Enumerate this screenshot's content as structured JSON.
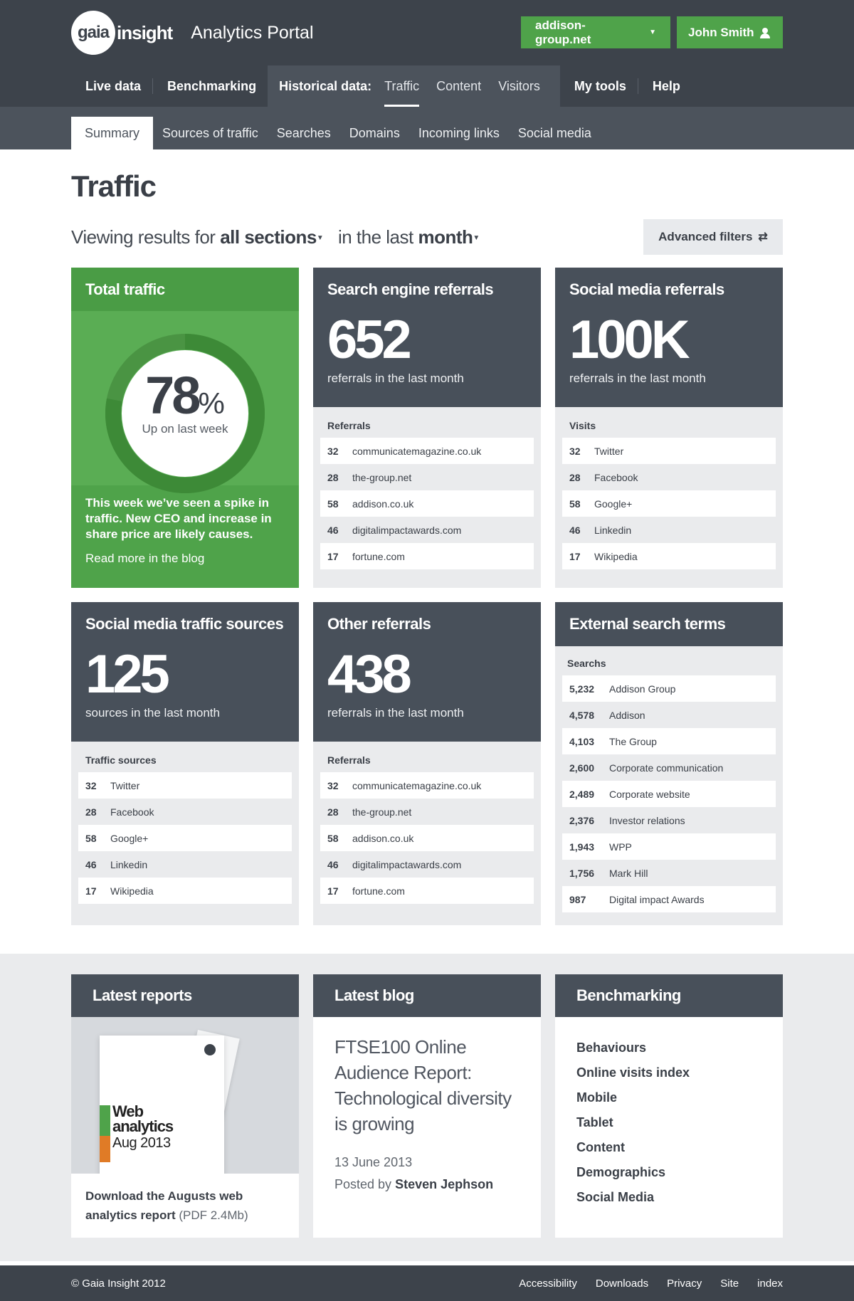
{
  "header": {
    "logo_circle": "gaia",
    "logo_word": "insight",
    "portal_title": "Analytics Portal",
    "site_button": "addison-group.net",
    "user_button": "John Smith"
  },
  "main_nav": {
    "live_data": "Live data",
    "benchmarking": "Benchmarking",
    "historical_label": "Historical data:",
    "historical_items": [
      "Traffic",
      "Content",
      "Visitors"
    ],
    "my_tools": "My tools",
    "help": "Help"
  },
  "sub_nav": [
    "Summary",
    "Sources of traffic",
    "Searches",
    "Domains",
    "Incoming links",
    "Social media"
  ],
  "page": {
    "title": "Traffic",
    "viewing_prefix": "Viewing results for",
    "sections": "all sections",
    "in_the_last": "in the last",
    "period": "month",
    "advanced_filters": "Advanced filters"
  },
  "total_traffic": {
    "title": "Total traffic",
    "percent": "78",
    "percent_sign": "%",
    "percent_value": 0.78,
    "subtitle": "Up on last week",
    "body": "This week we’ve seen a spike in traffic. New CEO and  increase in share price are likely causes.",
    "link": "Read more in the blog"
  },
  "search_engine": {
    "title": "Search engine referrals",
    "number": "652",
    "subtitle": "referrals in the last month",
    "list_label": "Referrals",
    "rows": [
      {
        "n": "32",
        "label": "communicatemagazine.co.uk"
      },
      {
        "n": "28",
        "label": "the-group.net"
      },
      {
        "n": "58",
        "label": "addison.co.uk"
      },
      {
        "n": "46",
        "label": "digitalimpactawards.com"
      },
      {
        "n": "17",
        "label": "fortune.com"
      }
    ]
  },
  "social_referrals": {
    "title": "Social media referrals",
    "number": "100K",
    "subtitle": "referrals in the last month",
    "list_label": "Visits",
    "rows": [
      {
        "n": "32",
        "label": "Twitter"
      },
      {
        "n": "28",
        "label": "Facebook"
      },
      {
        "n": "58",
        "label": "Google+"
      },
      {
        "n": "46",
        "label": "Linkedin"
      },
      {
        "n": "17",
        "label": "Wikipedia"
      }
    ]
  },
  "social_sources": {
    "title": "Social media traffic sources",
    "number": "125",
    "subtitle": "sources in the last month",
    "list_label": "Traffic sources",
    "rows": [
      {
        "n": "32",
        "label": "Twitter"
      },
      {
        "n": "28",
        "label": "Facebook"
      },
      {
        "n": "58",
        "label": "Google+"
      },
      {
        "n": "46",
        "label": "Linkedin"
      },
      {
        "n": "17",
        "label": "Wikipedia"
      }
    ]
  },
  "other_referrals": {
    "title": "Other referrals",
    "number": "438",
    "subtitle": "referrals in the last month",
    "list_label": "Referrals",
    "rows": [
      {
        "n": "32",
        "label": "communicatemagazine.co.uk"
      },
      {
        "n": "28",
        "label": "the-group.net"
      },
      {
        "n": "58",
        "label": "addison.co.uk"
      },
      {
        "n": "46",
        "label": "digitalimpactawards.com"
      },
      {
        "n": "17",
        "label": "fortune.com"
      }
    ]
  },
  "external_search": {
    "title": "External search terms",
    "list_label": "Searchs",
    "rows": [
      {
        "n": "5,232",
        "label": "Addison Group"
      },
      {
        "n": "4,578",
        "label": "Addison"
      },
      {
        "n": "4,103",
        "label": "The Group"
      },
      {
        "n": "2,600",
        "label": "Corporate communication"
      },
      {
        "n": "2,489",
        "label": "Corporate website"
      },
      {
        "n": "2,376",
        "label": "Investor relations"
      },
      {
        "n": "1,943",
        "label": "WPP"
      },
      {
        "n": "1,756",
        "label": "Mark Hill"
      },
      {
        "n": "987",
        "label": "Digital impact Awards"
      }
    ]
  },
  "latest_reports": {
    "title": "Latest reports",
    "cover_line1": "Web",
    "cover_line2": "analytics",
    "cover_line3": "Aug 2013",
    "link_bold": "Download the Augusts web analytics report",
    "link_meta": "(PDF 2.4Mb)"
  },
  "latest_blog": {
    "title": "Latest blog",
    "post_title": "FTSE100 Online Audience Report: Technological diversity is growing",
    "date": "13 June 2013",
    "posted_by": "Posted by",
    "author": "Steven Jephson"
  },
  "benchmarking": {
    "title": "Benchmarking",
    "items": [
      "Behaviours",
      "Online visits index",
      "Mobile",
      "Tablet",
      "Content",
      "Demographics",
      "Social Media"
    ]
  },
  "footer": {
    "copyright": "© Gaia Insight 2012",
    "links": [
      "Accessibility",
      "Downloads",
      "Privacy",
      "Site",
      "index"
    ]
  },
  "colors": {
    "header_bg": "#3d434b",
    "accent_green": "#4fa34a",
    "card_dark": "#48505a"
  }
}
